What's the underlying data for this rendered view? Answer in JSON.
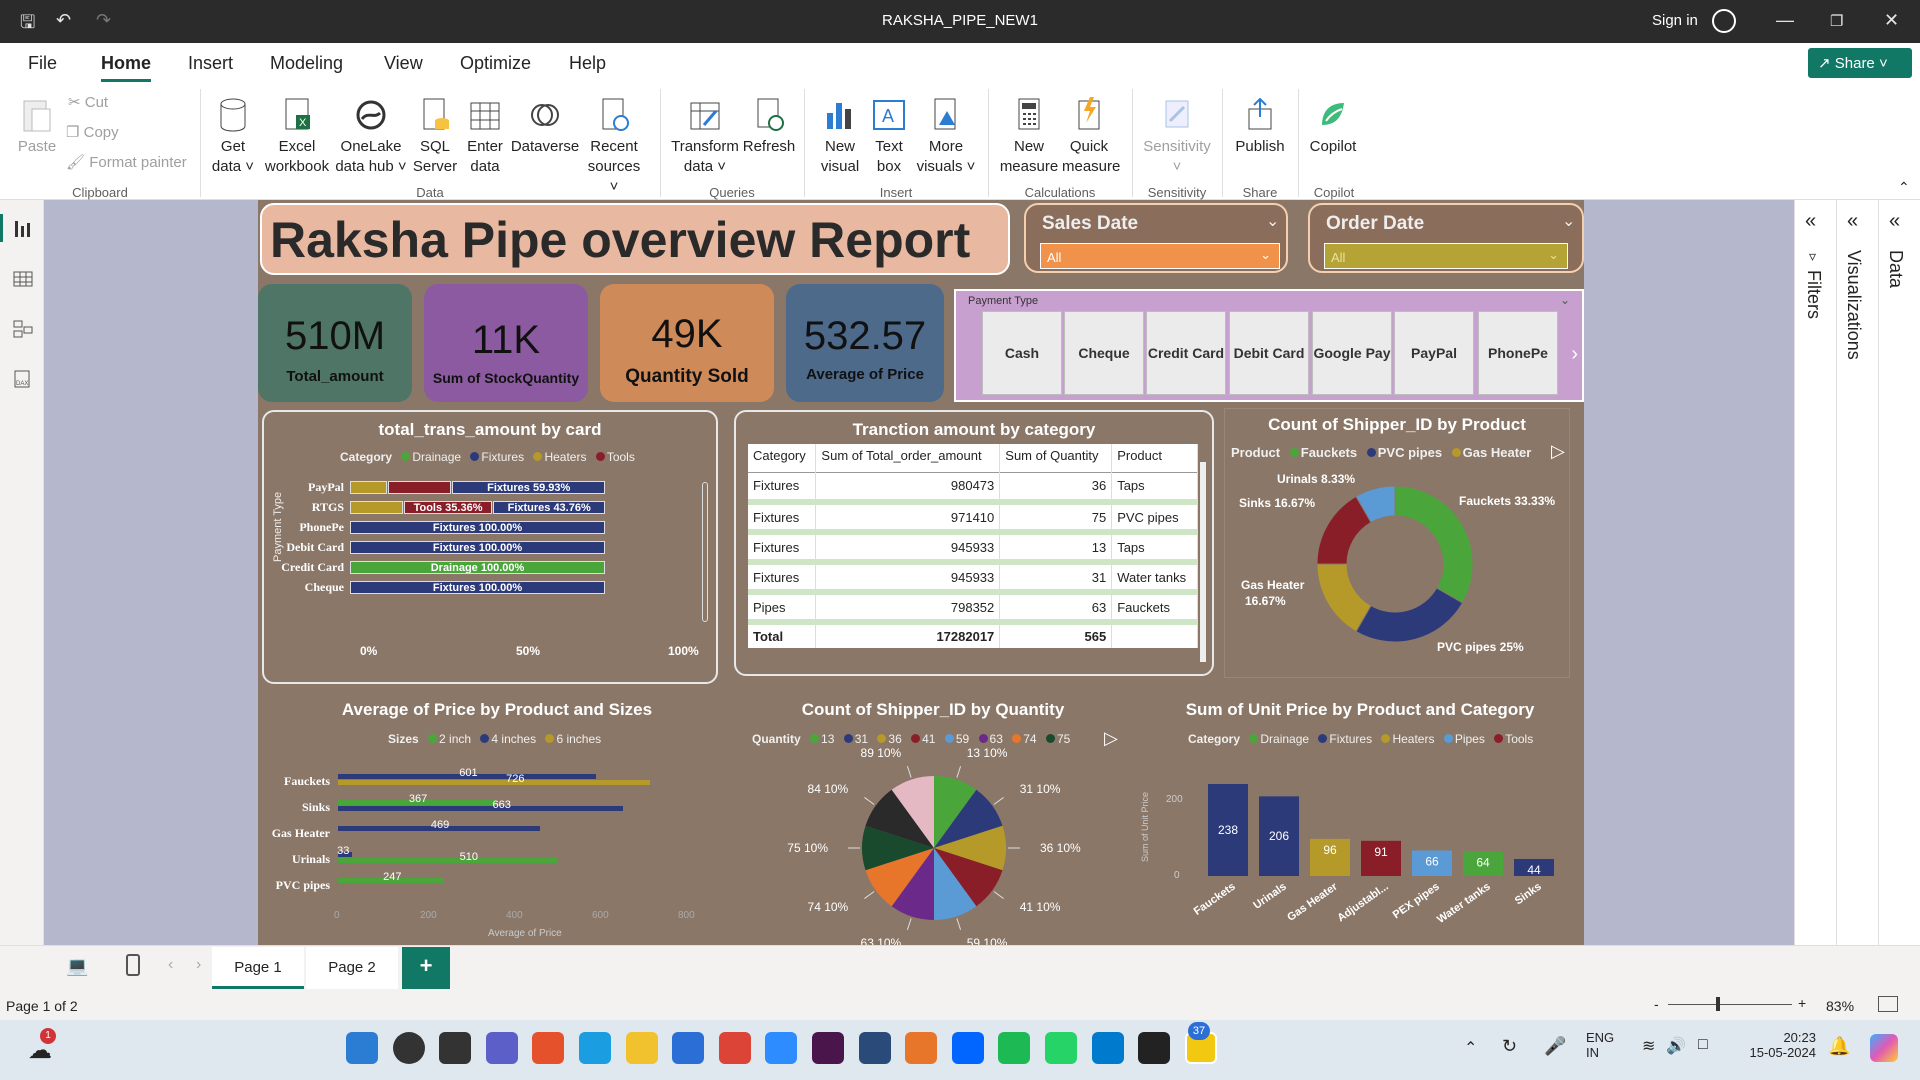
{
  "window": {
    "title": "RAKSHA_PIPE_NEW1",
    "sign_in": "Sign in"
  },
  "menu": [
    "File",
    "Home",
    "Insert",
    "Modeling",
    "View",
    "Optimize",
    "Help"
  ],
  "share_label": "Share",
  "ribbon": {
    "clipboard": {
      "paste": "Paste",
      "cut": "Cut",
      "copy": "Copy",
      "format_painter": "Format painter",
      "group": "Clipboard"
    },
    "data": {
      "get_data": "Get data",
      "excel": "Excel workbook",
      "onelake": "OneLake data hub",
      "sql": "SQL Server",
      "enter": "Enter data",
      "dataverse": "Dataverse",
      "recent": "Recent sources",
      "group": "Data"
    },
    "queries": {
      "transform": "Transform data",
      "refresh": "Refresh",
      "group": "Queries"
    },
    "insert": {
      "new_visual": "New visual",
      "text_box": "Text box",
      "more_visuals": "More visuals",
      "group": "Insert"
    },
    "calculations": {
      "new_measure": "New measure",
      "quick_measure": "Quick measure",
      "group": "Calculations"
    },
    "sensitivity": {
      "label": "Sensitivity",
      "group": "Sensitivity"
    },
    "share": {
      "publish": "Publish",
      "group": "Share"
    },
    "copilot": {
      "label": "Copilot",
      "group": "Copilot"
    }
  },
  "right_panes": {
    "filters": "Filters",
    "visualizations": "Visualizations",
    "data": "Data"
  },
  "report": {
    "title": "Raksha Pipe overview Report",
    "slicers": [
      {
        "label": "Sales Date",
        "value": "All",
        "color": "#f0924a"
      },
      {
        "label": "Order Date",
        "value": "All",
        "color": "#b5a435"
      }
    ],
    "kpis": [
      {
        "value": "510M",
        "label": "Total_amount",
        "color": "#4e7566"
      },
      {
        "value": "11K",
        "label": "Sum of StockQuantity",
        "color": "#8c5aa0"
      },
      {
        "value": "49K",
        "label": "Quantity Sold",
        "color": "#cf8a5a"
      },
      {
        "value": "532.57",
        "label": "Average of Price",
        "color": "#4d6a8a"
      }
    ],
    "payment_type": {
      "title": "Payment Type",
      "options": [
        "Cash",
        "Cheque",
        "Credit Card",
        "Debit Card",
        "Google Pay",
        "PayPal",
        "PhonePe"
      ]
    },
    "card_chart": {
      "title": "total_trans_amount by card",
      "legend_title": "Category",
      "legend": [
        {
          "name": "Drainage",
          "color": "#4aa63b"
        },
        {
          "name": "Fixtures",
          "color": "#2d3a7a"
        },
        {
          "name": "Heaters",
          "color": "#b59a2a"
        },
        {
          "name": "Tools",
          "color": "#8a1e28"
        }
      ],
      "axis_title": "Payment Type",
      "ticks": [
        "0%",
        "50%",
        "100%"
      ],
      "rows": [
        {
          "label": "PayPal",
          "segments": [
            {
              "color": "#b59a2a",
              "v": 0.15
            },
            {
              "color": "#8a1e28",
              "v": 0.25
            },
            {
              "color": "#2d3a7a",
              "v": 0.6,
              "text": "Fixtures 59.93%"
            }
          ]
        },
        {
          "label": "RTGS",
          "segments": [
            {
              "color": "#b59a2a",
              "v": 0.21
            },
            {
              "color": "#8a1e28",
              "v": 0.35,
              "text": "Tools 35.36%"
            },
            {
              "color": "#2d3a7a",
              "v": 0.44,
              "text": "Fixtures 43.76%"
            }
          ]
        },
        {
          "label": "PhonePe",
          "segments": [
            {
              "color": "#2d3a7a",
              "v": 1.0,
              "text": "Fixtures 100.00%"
            }
          ]
        },
        {
          "label": "Debit Card",
          "segments": [
            {
              "color": "#2d3a7a",
              "v": 1.0,
              "text": "Fixtures 100.00%"
            }
          ]
        },
        {
          "label": "Credit Card",
          "segments": [
            {
              "color": "#4aa63b",
              "v": 1.0,
              "text": "Drainage 100.00%"
            }
          ]
        },
        {
          "label": "Cheque",
          "segments": [
            {
              "color": "#2d3a7a",
              "v": 1.0,
              "text": "Fixtures 100.00%"
            }
          ]
        }
      ]
    },
    "table": {
      "title": "Tranction amount by category",
      "headers": [
        "Category",
        "Sum of Total_order_amount",
        "Sum of Quantity",
        "Product"
      ],
      "rows": [
        [
          "Fixtures",
          "980473",
          "36",
          "Taps"
        ],
        [
          "Fixtures",
          "971410",
          "75",
          "PVC pipes"
        ],
        [
          "Fixtures",
          "945933",
          "13",
          "Taps"
        ],
        [
          "Fixtures",
          "945933",
          "31",
          "Water tanks"
        ],
        [
          "Pipes",
          "798352",
          "63",
          "Faucke​ts"
        ]
      ],
      "total": [
        "Total",
        "17282017",
        "565",
        ""
      ]
    },
    "donut": {
      "title": "Count of Shipper_ID by Product",
      "legend_title": "Product",
      "legend": [
        {
          "name": "Faucke​ts",
          "color": "#4aa63b"
        },
        {
          "name": "PVC pipes",
          "color": "#2d3a7a"
        },
        {
          "name": "Gas Heater",
          "color": "#b59a2a"
        }
      ],
      "slices": [
        {
          "label": "Faucke​ts 33.33%",
          "value": 33.33,
          "color": "#4aa63b"
        },
        {
          "label": "PVC pipes 25%",
          "value": 25,
          "color": "#2d3a7a"
        },
        {
          "label": "Gas Heater 16.67%",
          "value": 16.67,
          "color": "#b59a2a"
        },
        {
          "label": "Sinks 16.67%",
          "value": 16.67,
          "color": "#8a1e28"
        },
        {
          "label": "Urinals 8.33%",
          "value": 8.33,
          "color": "#5b9bd5"
        }
      ]
    },
    "avg_price": {
      "title": "Average of Price by Product and Sizes",
      "legend_title": "Sizes",
      "legend": [
        {
          "name": "2 inch",
          "color": "#4aa63b"
        },
        {
          "name": "4 inches",
          "color": "#2d3a7a"
        },
        {
          "name": "6 inches",
          "color": "#b59a2a"
        }
      ],
      "xlabel": "Average of Price",
      "ticks": [
        "0",
        "200",
        "400",
        "600",
        "800"
      ],
      "rows": [
        {
          "label": "Faucke​ts",
          "bars": [
            {
              "v": 601,
              "c": "#2d3a7a",
              "t": "601"
            },
            {
              "v": 726,
              "c": "#b59a2a",
              "t": "726"
            }
          ]
        },
        {
          "label": "Sinks",
          "bars": [
            {
              "v": 367,
              "c": "#4aa63b",
              "t": "367"
            },
            {
              "v": 663,
              "c": "#2d3a7a",
              "t": "663"
            }
          ]
        },
        {
          "label": "Gas Heater",
          "bars": [
            {
              "v": 469,
              "c": "#2d3a7a",
              "t": "469"
            }
          ]
        },
        {
          "label": "Urinals",
          "bars": [
            {
              "v": 33,
              "c": "#2d3a7a",
              "t": "33"
            },
            {
              "v": 510,
              "c": "#4aa63b",
              "t": "510"
            }
          ]
        },
        {
          "label": "PVC pipes",
          "bars": [
            {
              "v": 247,
              "c": "#4aa63b",
              "t": "247"
            }
          ]
        }
      ]
    },
    "pie": {
      "title": "Count of Shipper_ID by Quantity",
      "legend_title": "Quantity",
      "legend": [
        {
          "name": "13",
          "color": "#4aa63b"
        },
        {
          "name": "31",
          "color": "#2d3a7a"
        },
        {
          "name": "36",
          "color": "#b59a2a"
        },
        {
          "name": "41",
          "color": "#8a1e28"
        },
        {
          "name": "59",
          "color": "#5b9bd5"
        },
        {
          "name": "63",
          "color": "#6b2a8a"
        },
        {
          "name": "74",
          "color": "#e8762a"
        },
        {
          "name": "75",
          "color": "#1a4a2e"
        }
      ],
      "slices": [
        {
          "label": "13 10%",
          "color": "#4aa63b"
        },
        {
          "label": "31 10%",
          "color": "#2d3a7a"
        },
        {
          "label": "36 10%",
          "color": "#b59a2a"
        },
        {
          "label": "41 10%",
          "color": "#8a1e28"
        },
        {
          "label": "59 10%",
          "color": "#5b9bd5"
        },
        {
          "label": "63 10%",
          "color": "#6b2a8a"
        },
        {
          "label": "74 10%",
          "color": "#e8762a"
        },
        {
          "label": "75 10%",
          "color": "#1a4a2e"
        },
        {
          "label": "84 10%",
          "color": "#2a2a2a"
        },
        {
          "label": "89 10%",
          "color": "#e5b9c3"
        }
      ]
    },
    "unit_price": {
      "title": "Sum of Unit Price by Product and Category",
      "legend_title": "Category",
      "legend": [
        {
          "name": "Drainage",
          "color": "#4aa63b"
        },
        {
          "name": "Fixtures",
          "color": "#2d3a7a"
        },
        {
          "name": "Heaters",
          "color": "#b59a2a"
        },
        {
          "name": "Pipes",
          "color": "#5b9bd5"
        },
        {
          "name": "Tools",
          "color": "#8a1e28"
        }
      ],
      "ylabel": "Sum of Unit Price",
      "yticks": [
        "200",
        "0"
      ],
      "bars": [
        {
          "label": "Faucke​ts",
          "value": 238,
          "color": "#2d3a7a"
        },
        {
          "label": "Urinals",
          "value": 206,
          "color": "#2d3a7a"
        },
        {
          "label": "Gas Heater",
          "value": 96,
          "color": "#b59a2a"
        },
        {
          "label": "Adjustabl...",
          "value": 91,
          "color": "#8a1e28"
        },
        {
          "label": "PEX pipes",
          "value": 66,
          "color": "#5b9bd5"
        },
        {
          "label": "Water tanks",
          "value": 64,
          "color": "#4aa63b"
        },
        {
          "label": "Sinks",
          "value": 44,
          "color": "#2d3a7a"
        }
      ]
    }
  },
  "pages": [
    "Page 1",
    "Page 2"
  ],
  "add_page": "+",
  "status": {
    "page": "Page 1 of 2",
    "zoom": "83%",
    "zoom_minus": "-",
    "zoom_plus": "+"
  },
  "taskbar": {
    "lang1": "ENG",
    "lang2": "IN",
    "time": "20:23",
    "date": "15-05-2024",
    "weather_badge": "1",
    "whatsapp_badge": "37"
  }
}
